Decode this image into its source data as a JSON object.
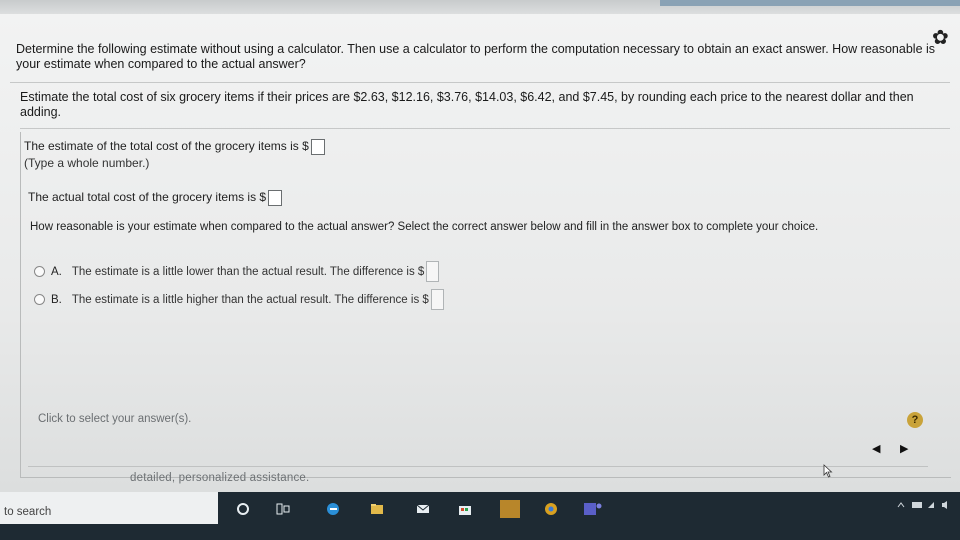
{
  "question": {
    "line1": "Determine the following estimate without using a calculator. Then use a calculator to perform the computation necessary to obtain an exact answer. How reasonable is",
    "line2": "your estimate when compared to the actual answer?"
  },
  "estimate": {
    "line1": "Estimate the total cost of six grocery items if their prices are $2.63, $12.16, $3.76, $14.03, $6.42, and $7.45, by rounding each price to the nearest dollar and then",
    "line2": "adding."
  },
  "rows": {
    "estimate_label": "The estimate of the total cost of the grocery items is $",
    "estimate_hint": "(Type a whole number.)",
    "actual_label": "The actual total cost of the grocery items is $",
    "reasonable_prompt": "How reasonable is your estimate when compared to the actual answer? Select the correct answer below and fill in the answer box to complete your choice."
  },
  "choices": [
    {
      "letter": "A.",
      "text": "The estimate is a little lower than the actual result. The difference is $"
    },
    {
      "letter": "B.",
      "text": "The estimate is a little higher than the actual result. The difference is $"
    }
  ],
  "footer": {
    "select_text": "Click to select your answer(s).",
    "help_label": "?",
    "prev_label": "◀",
    "next_label": "▶",
    "assist_text": "detailed, personalized assistance."
  },
  "taskbar": {
    "search_text": "to search"
  },
  "colors": {
    "taskbar": "#1e2a33",
    "help_badge": "#c9a33a"
  }
}
